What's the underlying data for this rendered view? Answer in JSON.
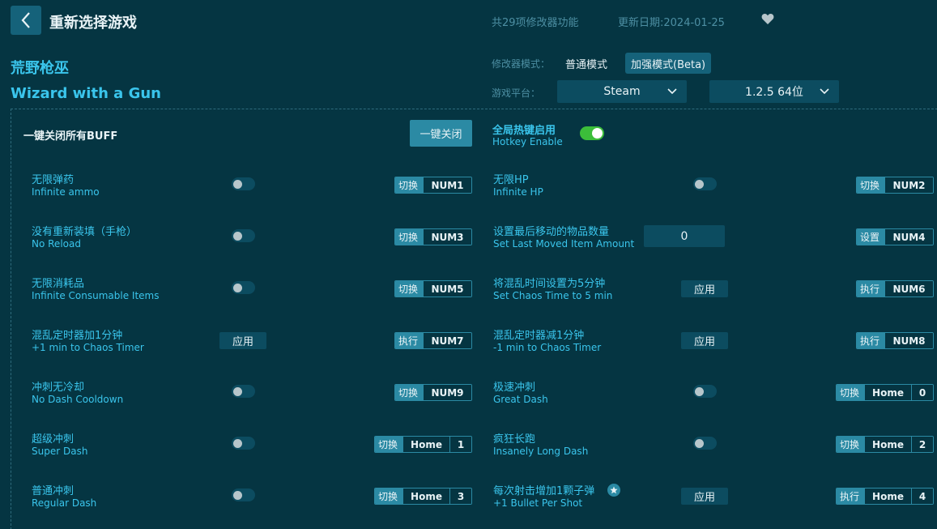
{
  "header": {
    "back_label": "重新选择游戏",
    "feature_count": "共29项修改器功能",
    "update_date": "更新日期:2024-01-25"
  },
  "game": {
    "name_cn": "荒野枪巫",
    "name_en": "Wizard with a Gun"
  },
  "mode": {
    "label": "修改器模式：",
    "normal": "普通模式",
    "enhanced": "加强模式(Beta)",
    "selected": "enhanced"
  },
  "platform": {
    "label": "游戏平台：",
    "platform_value": "Steam",
    "version_value": "1.2.5 64位"
  },
  "panel": {
    "buff_label": "一键关闭所有BUFF",
    "close_all_label": "一键关闭",
    "hotkey_cn": "全局热键启用",
    "hotkey_en": "Hotkey Enable",
    "hotkey_enabled": true
  },
  "cheats": [
    {
      "cn": "无限弹药",
      "en": "Infinite ammo",
      "control": "toggle",
      "action": "切换",
      "key1": "NUM1",
      "key2": ""
    },
    {
      "cn": "无限HP",
      "en": "Infinite HP",
      "control": "toggle",
      "action": "切换",
      "key1": "NUM2",
      "key2": ""
    },
    {
      "cn": "没有重新装填（手枪）",
      "en": "No Reload",
      "control": "toggle",
      "action": "切换",
      "key1": "NUM3",
      "key2": ""
    },
    {
      "cn": "设置最后移动的物品数量",
      "en": "Set Last Moved Item Amount",
      "control": "input",
      "value": "0",
      "action": "设置",
      "key1": "NUM4",
      "key2": ""
    },
    {
      "cn": "无限消耗品",
      "en": "Infinite Consumable Items",
      "control": "toggle",
      "action": "切换",
      "key1": "NUM5",
      "key2": ""
    },
    {
      "cn": "将混乱时间设置为5分钟",
      "en": "Set Chaos Time to 5 min",
      "control": "apply",
      "apply_label": "应用",
      "action": "执行",
      "key1": "NUM6",
      "key2": ""
    },
    {
      "cn": "混乱定时器加1分钟",
      "en": "+1 min to Chaos Timer",
      "control": "apply",
      "apply_label": "应用",
      "action": "执行",
      "key1": "NUM7",
      "key2": ""
    },
    {
      "cn": "混乱定时器减1分钟",
      "en": "-1 min to Chaos Timer",
      "control": "apply",
      "apply_label": "应用",
      "action": "执行",
      "key1": "NUM8",
      "key2": ""
    },
    {
      "cn": "冲刺无冷却",
      "en": "No Dash Cooldown",
      "control": "toggle",
      "action": "切换",
      "key1": "NUM9",
      "key2": ""
    },
    {
      "cn": "极速冲刺",
      "en": "Great Dash",
      "control": "toggle",
      "action": "切换",
      "key1": "Home",
      "key2": "0"
    },
    {
      "cn": "超级冲刺",
      "en": "Super Dash",
      "control": "toggle",
      "action": "切换",
      "key1": "Home",
      "key2": "1"
    },
    {
      "cn": "疯狂长跑",
      "en": "Insanely Long Dash",
      "control": "toggle",
      "action": "切换",
      "key1": "Home",
      "key2": "2"
    },
    {
      "cn": "普通冲刺",
      "en": "Regular Dash",
      "control": "toggle",
      "action": "切换",
      "key1": "Home",
      "key2": "3"
    },
    {
      "cn": "每次射击增加1颗子弹",
      "en": "+1 Bullet Per Shot",
      "control": "apply",
      "apply_label": "应用",
      "action": "执行",
      "key1": "Home",
      "key2": "4",
      "starred": true
    }
  ],
  "colors": {
    "background": "#053542",
    "accent": "#3ac5ec",
    "button": "#2b8aa4",
    "switch_on": "#3cbe3a"
  }
}
